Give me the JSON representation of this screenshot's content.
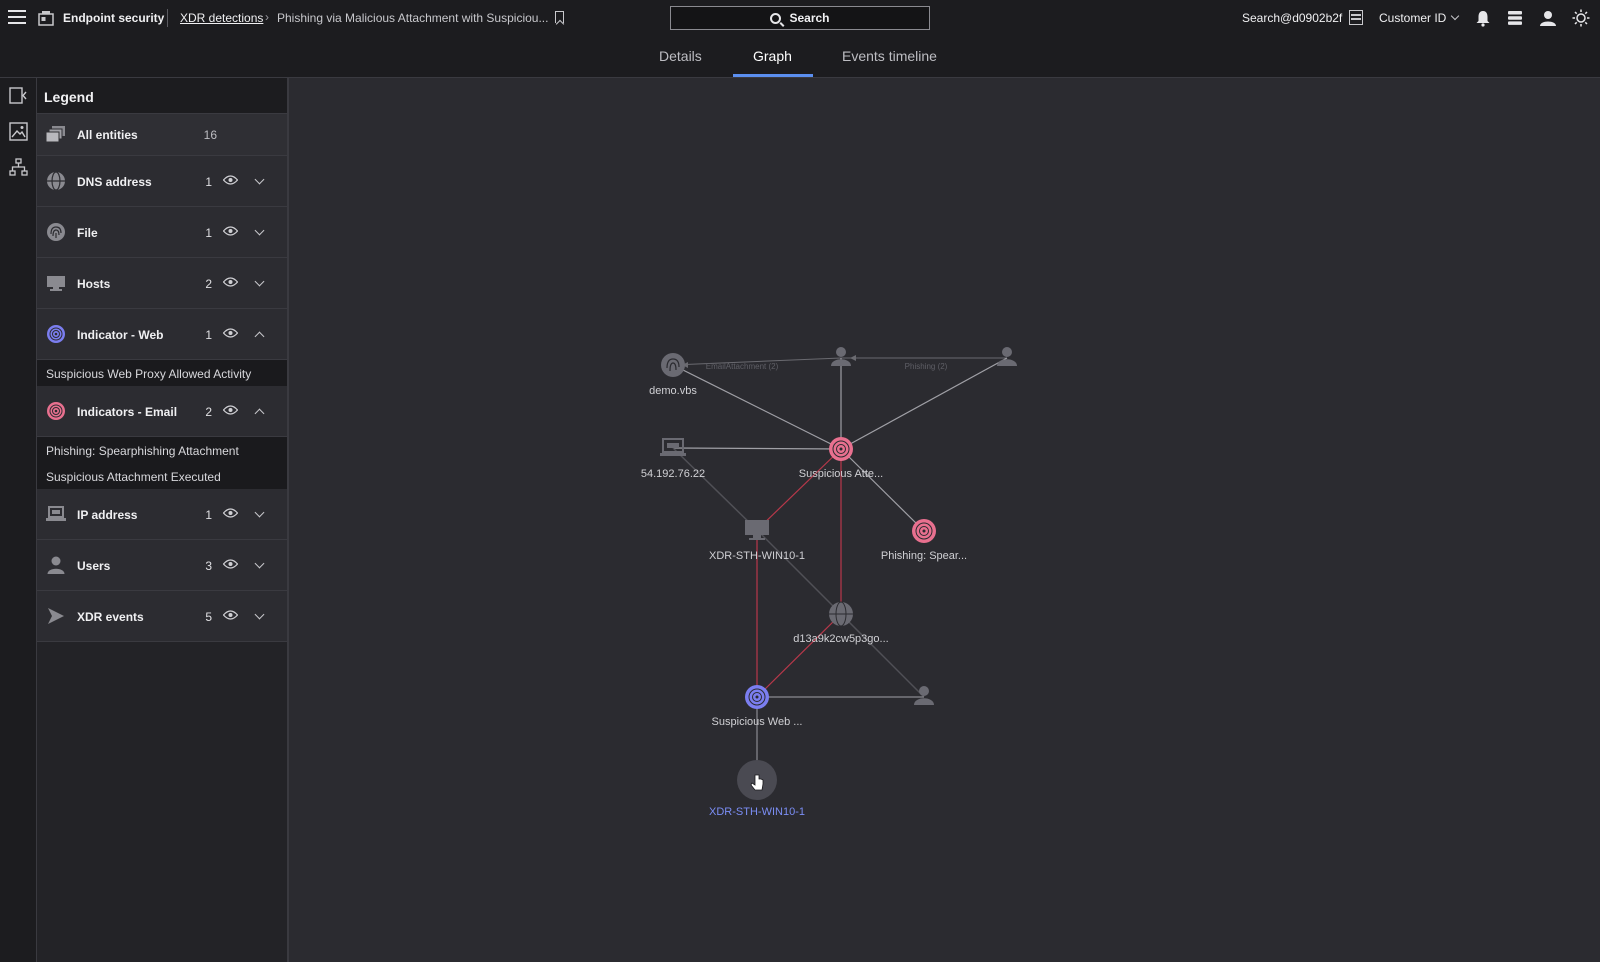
{
  "header": {
    "app_title": "Endpoint security",
    "breadcrumb_link": "XDR detections",
    "breadcrumb_current": "Phishing via Malicious Attachment with Suspiciou...",
    "search_label": "Search",
    "account": "Search@d0902b2f",
    "customer": "Customer ID"
  },
  "tabs": [
    {
      "label": "Details"
    },
    {
      "label": "Graph",
      "active": true
    },
    {
      "label": "Events timeline"
    }
  ],
  "legend": {
    "title": "Legend",
    "all": {
      "label": "All entities",
      "count": "16"
    },
    "rows": [
      {
        "label": "DNS address",
        "count": "1",
        "icon": "globe-icon"
      },
      {
        "label": "File",
        "count": "1",
        "icon": "fingerprint-icon"
      },
      {
        "label": "Hosts",
        "count": "2",
        "icon": "monitor-icon"
      },
      {
        "label": "Indicator - Web",
        "count": "1",
        "icon": "radar-icon",
        "expanded": true,
        "items": [
          "Suspicious Web Proxy Allowed Activity"
        ]
      },
      {
        "label": "Indicators - Email",
        "count": "2",
        "icon": "radar-icon",
        "expanded": true,
        "items": [
          "Phishing: Spearphishing Attachment",
          "Suspicious Attachment Executed"
        ]
      },
      {
        "label": "IP address",
        "count": "1",
        "icon": "laptop-icon"
      },
      {
        "label": "Users",
        "count": "3",
        "icon": "user-icon"
      },
      {
        "label": "XDR events",
        "count": "5",
        "icon": "arrow-icon"
      }
    ]
  },
  "graph": {
    "nodes": [
      {
        "id": "demo",
        "label": "demo.vbs"
      },
      {
        "id": "ip",
        "label": "54.192.76.22"
      },
      {
        "id": "susp_att",
        "label": "Suspicious Atte..."
      },
      {
        "id": "host1",
        "label": "XDR-STH-WIN10-1"
      },
      {
        "id": "phish",
        "label": "Phishing: Spear..."
      },
      {
        "id": "dns",
        "label": "d13a9k2cw5p3go..."
      },
      {
        "id": "web",
        "label": "Suspicious Web ..."
      },
      {
        "id": "host2",
        "label": "XDR-STH-WIN10-1"
      }
    ],
    "edge_labels": [
      "EmailAttachment (2)",
      "Phishing (2)"
    ]
  },
  "colors": {
    "accent": "#5b8ff0",
    "email_indicator": "#e8708f",
    "web_indicator": "#7b7ef0",
    "edge_red": "#b8384a",
    "edge_gray": "#8a8a90"
  }
}
